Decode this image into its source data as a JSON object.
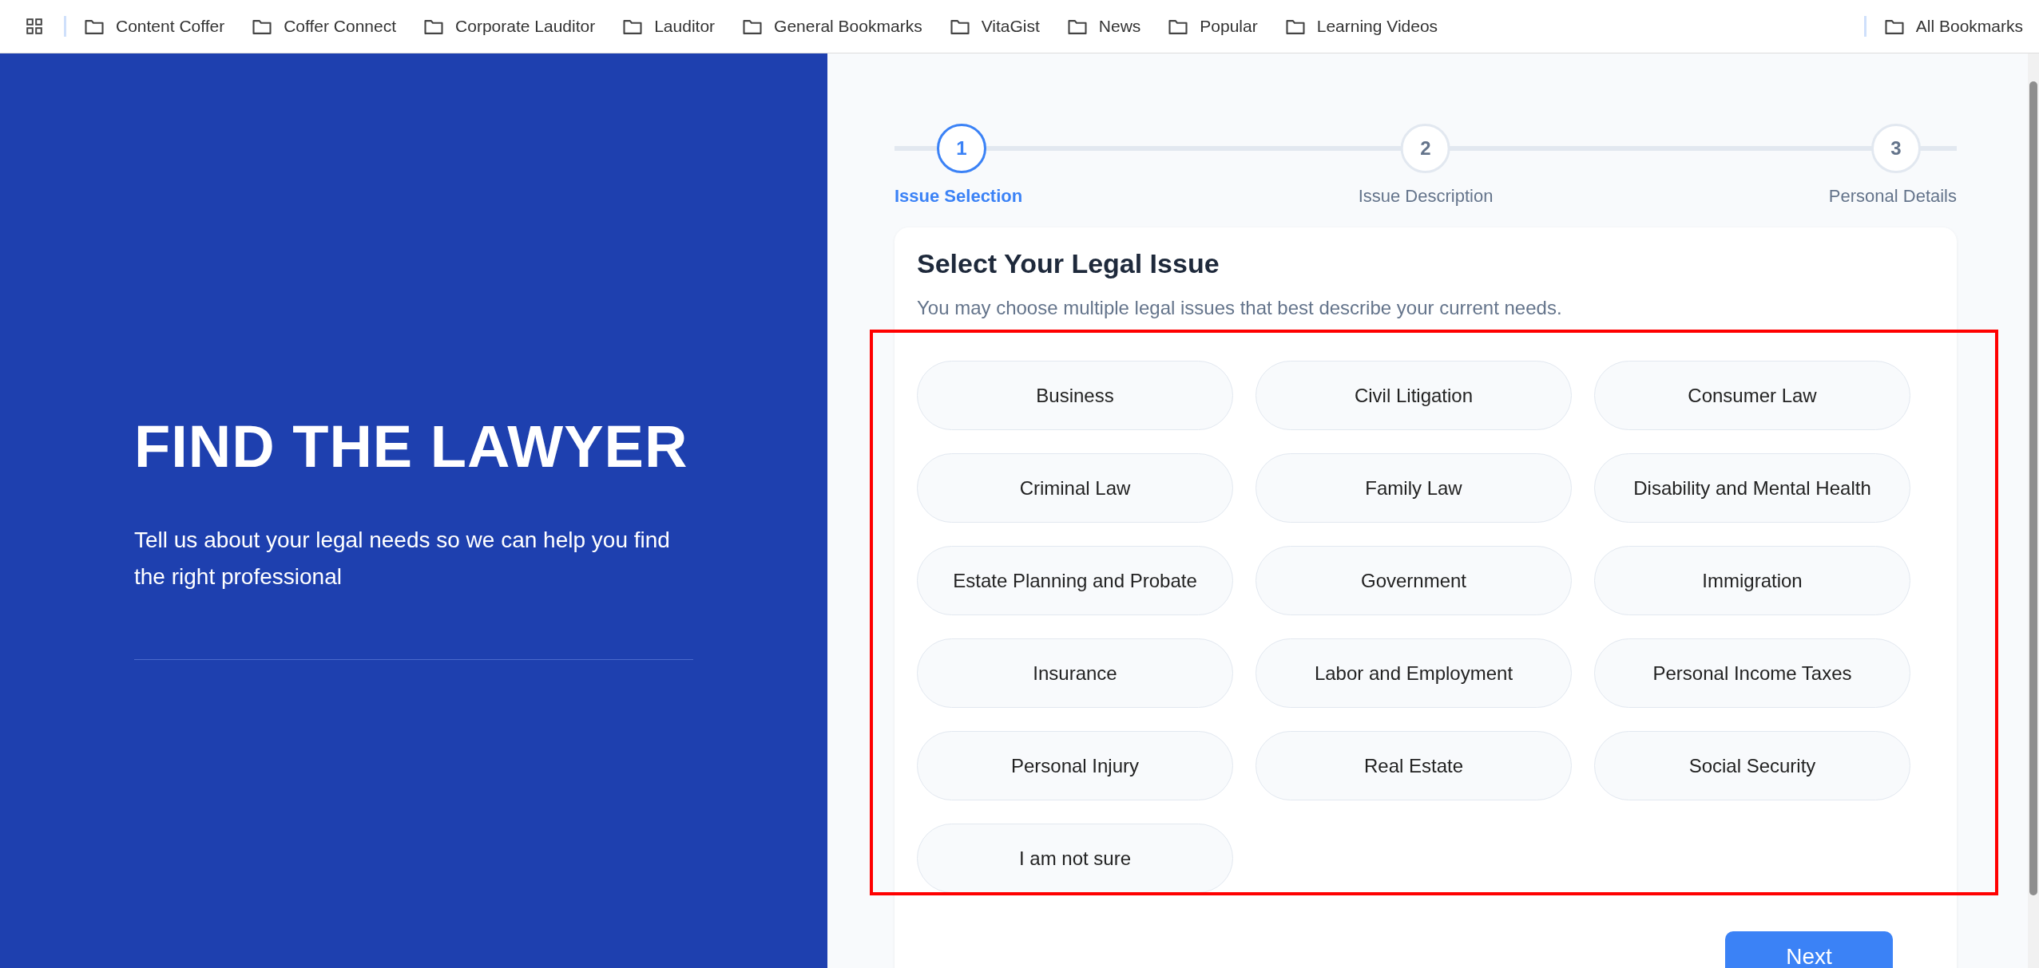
{
  "bookmarks_bar": {
    "items": [
      {
        "label": "Content Coffer"
      },
      {
        "label": "Coffer Connect"
      },
      {
        "label": "Corporate Lauditor"
      },
      {
        "label": "Lauditor"
      },
      {
        "label": "General Bookmarks"
      },
      {
        "label": "VitaGist"
      },
      {
        "label": "News"
      },
      {
        "label": "Popular"
      },
      {
        "label": "Learning Videos"
      }
    ],
    "all_bookmarks": "All Bookmarks"
  },
  "hero": {
    "title": "FIND THE LAWYER",
    "subtitle": "Tell us about your legal needs so we can help you find the right professional"
  },
  "stepper": {
    "steps": [
      {
        "number": "1",
        "label": "Issue Selection",
        "selected": true
      },
      {
        "number": "2",
        "label": "Issue Description",
        "selected": false
      },
      {
        "number": "3",
        "label": "Personal Details",
        "selected": false
      }
    ]
  },
  "card": {
    "title": "Select Your Legal Issue",
    "subtitle": "You may choose multiple legal issues that best describe your current needs.",
    "issues": [
      {
        "label": "Business",
        "selected": false
      },
      {
        "label": "Civil Litigation",
        "selected": false
      },
      {
        "label": "Consumer Law",
        "selected": false
      },
      {
        "label": "Criminal Law",
        "selected": false
      },
      {
        "label": "Family Law",
        "selected": false
      },
      {
        "label": "Disability and Mental Health",
        "selected": false
      },
      {
        "label": "Estate Planning and Probate",
        "selected": false
      },
      {
        "label": "Government",
        "selected": false
      },
      {
        "label": "Immigration",
        "selected": false
      },
      {
        "label": "Insurance",
        "selected": false
      },
      {
        "label": "Labor and Employment",
        "selected": false
      },
      {
        "label": "Personal Income Taxes",
        "selected": false
      },
      {
        "label": "Personal Injury",
        "selected": false
      },
      {
        "label": "Real Estate",
        "selected": false
      },
      {
        "label": "Social Security",
        "selected": false
      },
      {
        "label": "I am not sure",
        "selected": false
      }
    ],
    "next_button": "Next"
  }
}
